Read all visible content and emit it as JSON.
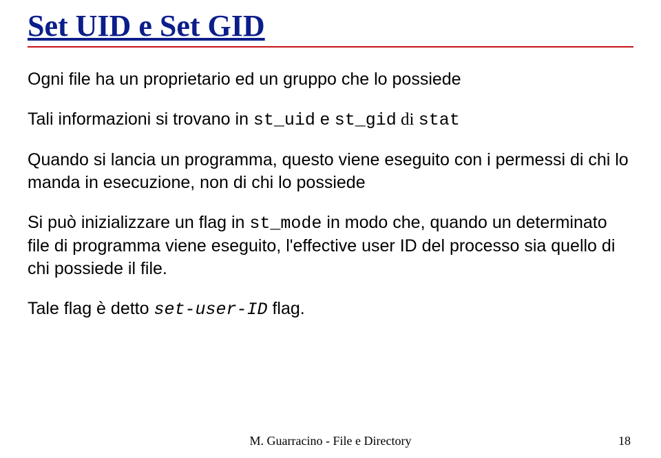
{
  "title": "Set UID e Set GID",
  "p1_a": "Ogni file ha un proprietario ed un gruppo che lo possiede",
  "p2": {
    "a": "Tali informazioni si trovano in ",
    "b": "st_uid",
    "c": " e ",
    "d": "st_gid",
    "e": " di ",
    "f": "stat"
  },
  "p3": "Quando si lancia un programma, questo viene eseguito con i permessi di chi lo manda in esecuzione, non di chi lo possiede",
  "p4": {
    "a": "Si può inizializzare un flag in ",
    "b": "st_mode",
    "c": " in modo che, quando un determinato file di programma viene eseguito, l'effective user ID del processo sia quello di chi possiede il file."
  },
  "p5": {
    "a": "Tale flag è detto ",
    "b": "set-user-ID",
    "c": " flag."
  },
  "footer": "M. Guarracino - File e Directory",
  "page": "18"
}
